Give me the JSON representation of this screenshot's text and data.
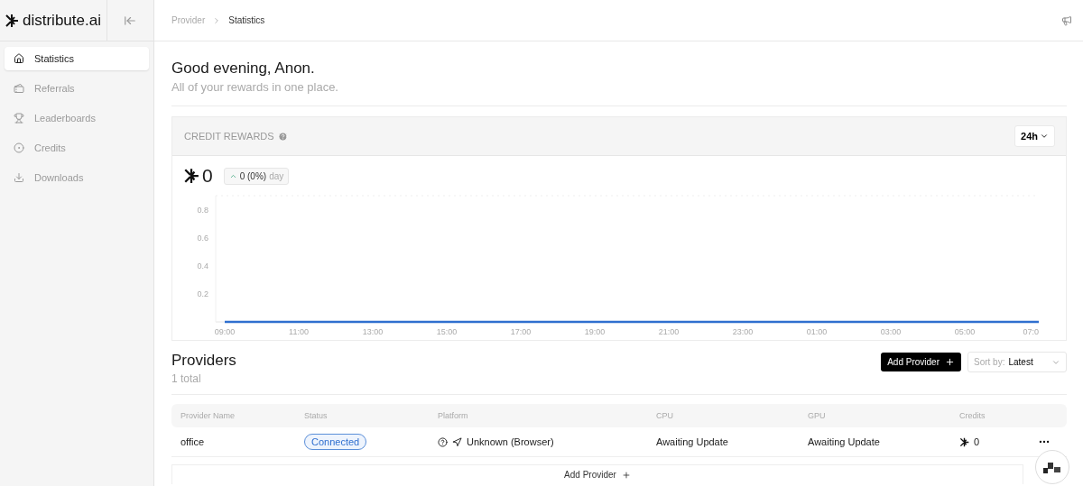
{
  "sidebar": {
    "logo": "distribute.ai",
    "items": [
      {
        "label": "Statistics",
        "selected": true
      },
      {
        "label": "Referrals",
        "selected": false
      },
      {
        "label": "Leaderboards",
        "selected": false
      },
      {
        "label": "Credits",
        "selected": false
      },
      {
        "label": "Downloads",
        "selected": false
      }
    ]
  },
  "breadcrumb": [
    "Provider",
    "Statistics"
  ],
  "greeting": {
    "title": "Good evening, Anon.",
    "subtitle": "All of your rewards in one place."
  },
  "rewards": {
    "title": "CREDIT REWARDS",
    "range": "24h",
    "total": "0",
    "change": "0 (0%)",
    "change_period": "day",
    "chart_data": {
      "type": "line",
      "categories": [
        "09:00",
        "11:00",
        "13:00",
        "15:00",
        "17:00",
        "19:00",
        "21:00",
        "23:00",
        "01:00",
        "03:00",
        "05:00",
        "07:0"
      ],
      "series": [
        {
          "color": "#2f6fcf",
          "values": [
            0,
            0,
            0,
            0,
            0,
            0,
            0,
            0,
            0,
            0,
            0,
            0
          ]
        }
      ],
      "ylim": [
        0,
        0.9
      ],
      "yticks": [
        0.2,
        0.4,
        0.6,
        0.8
      ]
    }
  },
  "providers": {
    "title": "Providers",
    "count": "1 total",
    "add_button": "Add Provider",
    "sort_label": "Sort by:",
    "sort_value": "Latest",
    "columns": [
      "Provider Name",
      "Status",
      "Platform",
      "CPU",
      "GPU",
      "Credits"
    ],
    "rows": [
      {
        "name": "office",
        "status": "Connected",
        "platform": "Unknown (Browser)",
        "cpu": "Awaiting Update",
        "gpu": "Awaiting Update",
        "credits": "0"
      }
    ],
    "footer_button": "Add Provider"
  }
}
